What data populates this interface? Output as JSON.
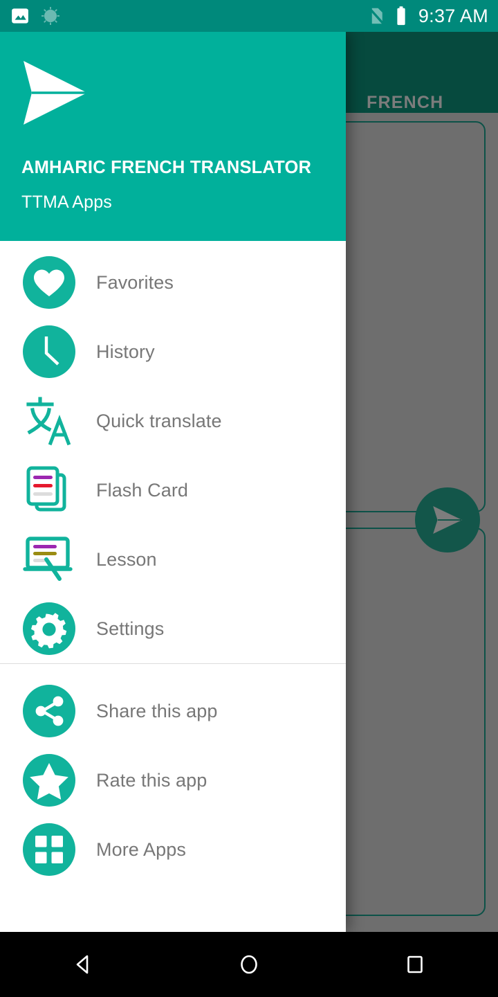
{
  "status_bar": {
    "icons": [
      {
        "name": "photo-icon",
        "label": "Photo"
      },
      {
        "name": "screenshot-processing-icon",
        "label": "Processing"
      }
    ],
    "right_icons": [
      {
        "name": "no-sim-card-icon",
        "label": "No SIM card"
      },
      {
        "name": "battery-full-icon",
        "label": "Battery full"
      }
    ],
    "time": "9:37 AM",
    "background_color": "#00897b"
  },
  "background_app": {
    "appbar": {
      "title": "FRENCH",
      "background_color": "#064a3e",
      "title_color": "#7c7c7c"
    },
    "fab": {
      "name": "send-translate-fab",
      "background_color": "#13564a"
    },
    "cards": [
      {
        "name": "source-text-card"
      },
      {
        "name": "target-text-card"
      }
    ],
    "scrim_color": "#6e6e6e"
  },
  "drawer": {
    "header": {
      "logo_icon": "send-plane-logo",
      "title": "AMHARIC FRENCH TRANSLATOR",
      "subtitle": "TTMA Apps",
      "background_color": "#01b09b"
    },
    "accent_color": "#11b39c",
    "items_primary": [
      {
        "label": "Favorites",
        "icon": "heart-icon",
        "name": "drawer-item-favorites"
      },
      {
        "label": "History",
        "icon": "clock-icon",
        "name": "drawer-item-history"
      },
      {
        "label": "Quick translate",
        "icon": "translate-icon",
        "name": "drawer-item-quick-translate"
      },
      {
        "label": "Flash Card",
        "icon": "flash-card-icon",
        "name": "drawer-item-flash-card"
      },
      {
        "label": "Lesson",
        "icon": "lesson-board-icon",
        "name": "drawer-item-lesson"
      },
      {
        "label": "Settings",
        "icon": "gear-icon",
        "name": "drawer-item-settings"
      }
    ],
    "items_secondary": [
      {
        "label": "Share this app",
        "icon": "share-icon",
        "name": "drawer-item-share-this-app"
      },
      {
        "label": "Rate this app",
        "icon": "star-icon",
        "name": "drawer-item-rate-this-app"
      },
      {
        "label": "More Apps",
        "icon": "grid-apps-icon",
        "name": "drawer-item-more-apps"
      }
    ]
  },
  "nav_bar": {
    "buttons": [
      {
        "name": "nav-back-button",
        "label": "Back"
      },
      {
        "name": "nav-home-button",
        "label": "Home"
      },
      {
        "name": "nav-recents-button",
        "label": "Recents"
      }
    ],
    "background_color": "#000000"
  }
}
